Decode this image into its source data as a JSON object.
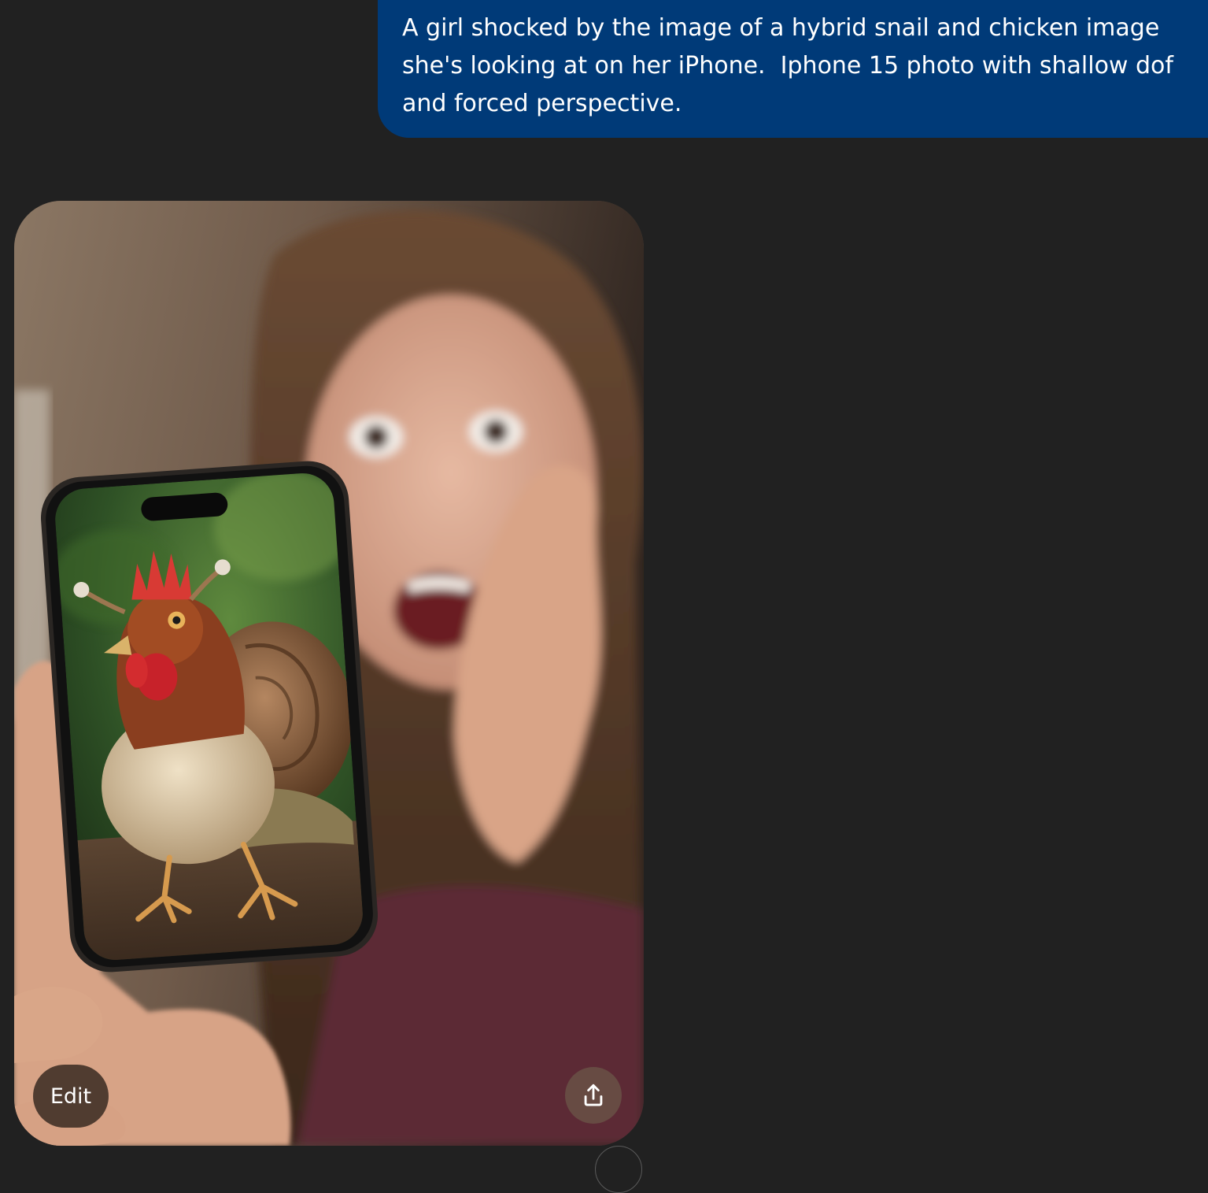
{
  "prompt": {
    "text": "A girl shocked by the image of a hybrid snail and chicken image she's looking at on her iPhone.  Iphone 15 photo with shallow dof and forced perspective."
  },
  "image_card": {
    "edit_label": "Edit",
    "share_icon": "share-upload-icon"
  },
  "colors": {
    "page_background": "#212121",
    "prompt_bubble": "#003a78",
    "text": "#ffffff"
  }
}
